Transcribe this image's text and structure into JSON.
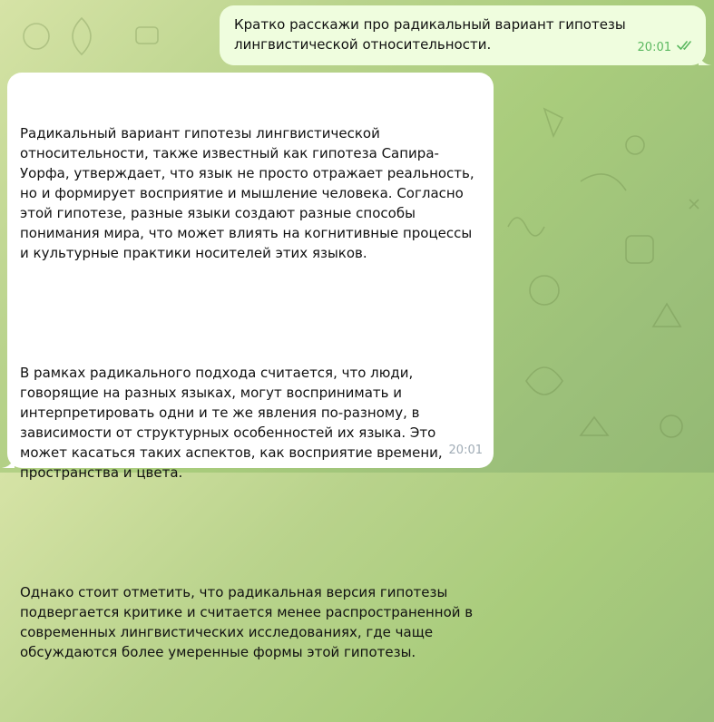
{
  "chat": {
    "outgoing": {
      "text": "Кратко расскажи про радикальный вариант гипотезы лингвистической относительности.",
      "time": "20:01",
      "status_icon": "double-check-icon",
      "bubble_color": "#effdde",
      "meta_color": "#5bb860"
    },
    "incoming": {
      "paragraphs": [
        "Радикальный вариант гипотезы лингвистической относительности, также известный как гипотеза Сапира-Уорфа, утверждает, что язык не просто отражает реальность, но и формирует восприятие и мышление человека. Согласно этой гипотезе, разные языки создают разные способы понимания мира, что может влиять на когнитивные процессы и культурные практики носителей этих языков.",
        "В рамках радикального подхода считается, что люди, говорящие на разных языках, могут воспринимать и интерпретировать одни и те же явления по-разному, в зависимости от структурных особенностей их языка. Это может касаться таких аспектов, как восприятие времени, пространства и цвета.",
        "Однако стоит отметить, что радикальная версия гипотезы подвергается критике и считается менее распространенной в современных лингвистических исследованиях, где чаще обсуждаются более умеренные формы этой гипотезы."
      ],
      "time": "20:01",
      "bubble_color": "#ffffff"
    }
  },
  "background": {
    "colors": [
      "#d6e3a6",
      "#a9cc7c",
      "#94b974"
    ]
  }
}
